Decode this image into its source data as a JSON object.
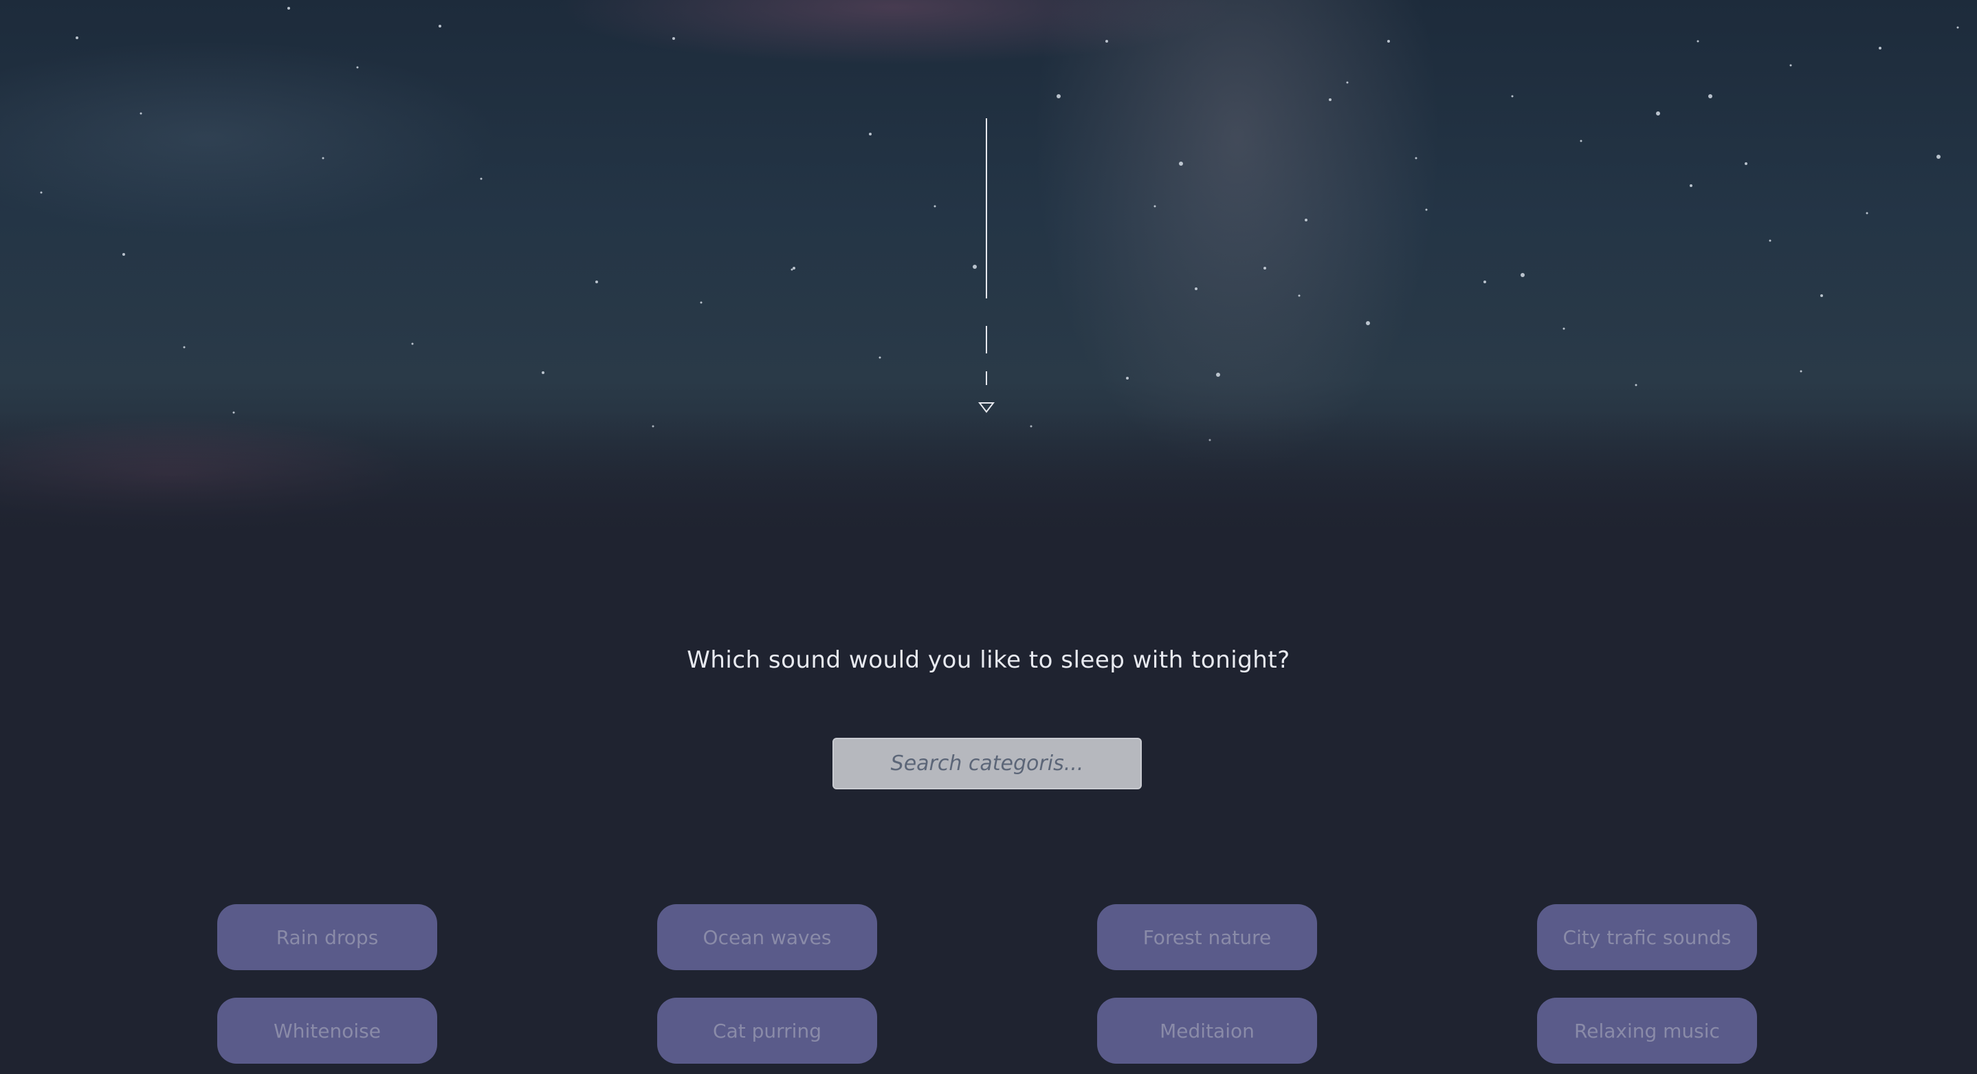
{
  "hero": {
    "scroll_indicator": "scroll-down-indicator"
  },
  "main": {
    "question": "Which sound would you like to sleep with tonight?",
    "search": {
      "placeholder": "Search categoris...",
      "value": ""
    },
    "categories": [
      {
        "label": "Rain drops"
      },
      {
        "label": "Ocean waves"
      },
      {
        "label": "Forest nature"
      },
      {
        "label": "City trafic sounds"
      },
      {
        "label": "Whitenoise"
      },
      {
        "label": "Cat purring"
      },
      {
        "label": "Meditaion"
      },
      {
        "label": "Relaxing music"
      }
    ]
  },
  "colors": {
    "background": "#1f2330",
    "category_button": "#5a5b8a",
    "category_text": "#8a8ba8",
    "search_background": "#b6b8be",
    "question_text": "#e8eaf0"
  }
}
